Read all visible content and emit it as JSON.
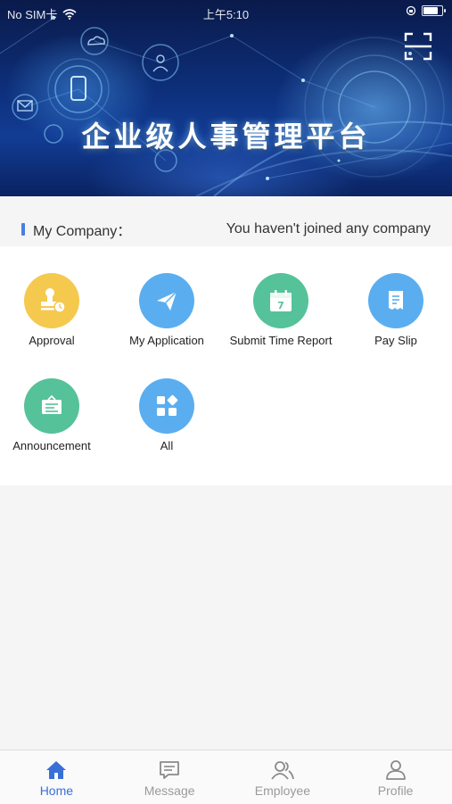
{
  "status_bar": {
    "carrier": "No SIM卡",
    "time": "上午5:10",
    "wifi_icon": "wifi-icon",
    "lock_icon": "orientation-lock-icon",
    "battery_icon": "battery-icon"
  },
  "banner": {
    "title": "企业级人事管理平台",
    "scan_icon": "scan-icon"
  },
  "company": {
    "label": "My Company：",
    "status": "You haven't joined any company"
  },
  "grid": {
    "items": [
      {
        "label": "Approval",
        "icon": "stamp-icon",
        "color": "#f5c94e"
      },
      {
        "label": "My Application",
        "icon": "paper-plane-icon",
        "color": "#5aaef0"
      },
      {
        "label": "Submit Time Report",
        "icon": "calendar-icon",
        "color": "#55c29a"
      },
      {
        "label": "Pay Slip",
        "icon": "receipt-icon",
        "color": "#5aaef0"
      },
      {
        "label": "Announcement",
        "icon": "notice-board-icon",
        "color": "#55c29a"
      },
      {
        "label": "All",
        "icon": "grid-icon",
        "color": "#5aaef0"
      }
    ]
  },
  "tabs": [
    {
      "label": "Home",
      "icon": "home-icon",
      "active": true
    },
    {
      "label": "Message",
      "icon": "message-icon",
      "active": false
    },
    {
      "label": "Employee",
      "icon": "employee-icon",
      "active": false
    },
    {
      "label": "Profile",
      "icon": "profile-icon",
      "active": false
    }
  ],
  "colors": {
    "accent": "#3a6fd8",
    "tab_inactive": "#9a9a9a",
    "page_bg": "#f5f5f5"
  }
}
